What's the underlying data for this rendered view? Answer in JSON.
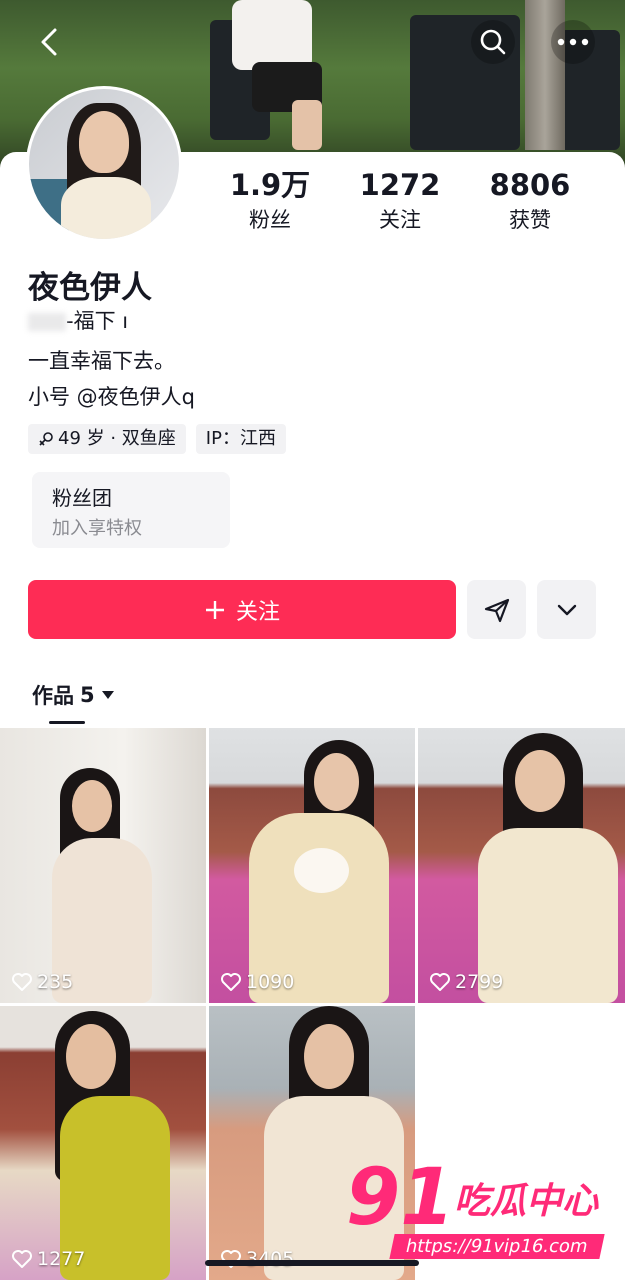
{
  "profile": {
    "stats": [
      {
        "num": "1.9万",
        "label": "粉丝"
      },
      {
        "num": "1272",
        "label": "关注"
      },
      {
        "num": "8806",
        "label": "获赞"
      }
    ],
    "name": "夜色伊人",
    "bio_line1": "-福下 ı",
    "bio_line2": "一直幸福下去。",
    "bio_line3": "小号 @夜色伊人q",
    "tags": {
      "age": "49 岁 · 双鱼座",
      "ip": "IP：江西"
    },
    "fan_club": {
      "title": "粉丝团",
      "subtitle": "加入享特权"
    }
  },
  "actions": {
    "follow_label": "关注"
  },
  "works": {
    "tab_label": "作品",
    "count": "5",
    "items": [
      {
        "likes": "235"
      },
      {
        "likes": "1090"
      },
      {
        "likes": "2799"
      },
      {
        "likes": "1277"
      },
      {
        "likes": "3405"
      }
    ]
  },
  "watermark": {
    "big": "91",
    "text": "吃瓜中心",
    "url": "https://91vip16.com"
  },
  "colors": {
    "accent": "#fe2c55",
    "watermark": "#ff2a78",
    "text": "#161823"
  }
}
